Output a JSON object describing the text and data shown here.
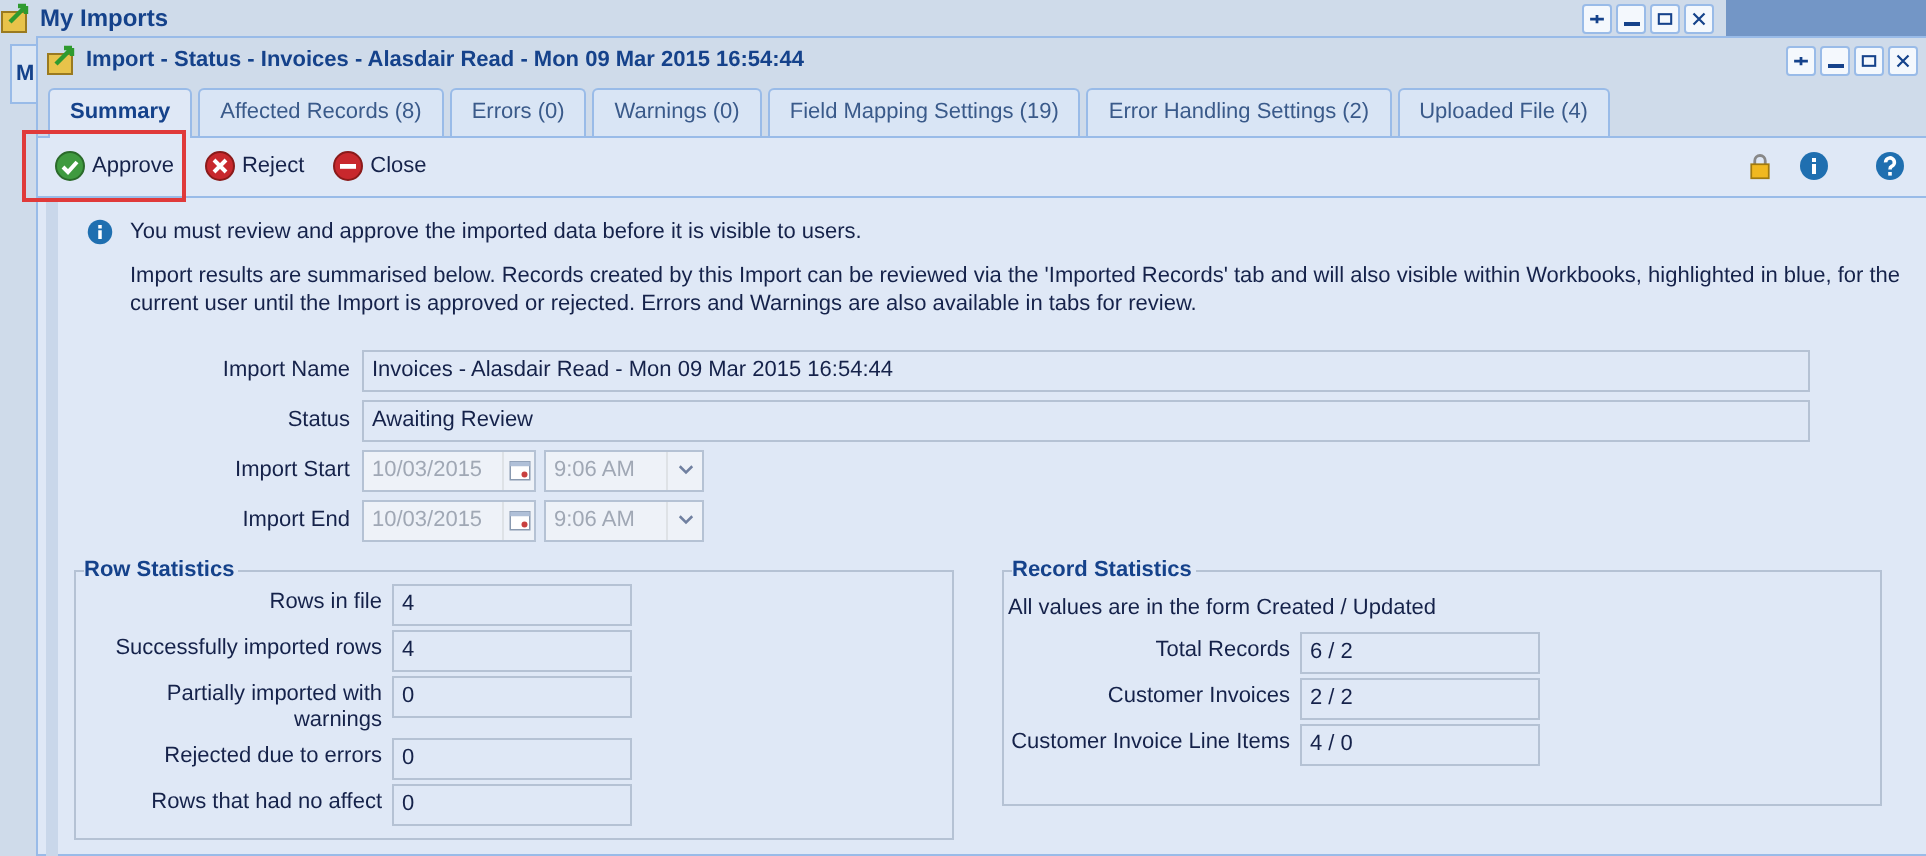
{
  "outer_window": {
    "title": "My Imports",
    "background_tab": "M"
  },
  "window": {
    "title": "Import - Status - Invoices - Alasdair Read - Mon 09 Mar 2015 16:54:44"
  },
  "tabs": [
    {
      "label": "Summary",
      "selected": true
    },
    {
      "label": "Affected Records (8)",
      "selected": false
    },
    {
      "label": "Errors (0)",
      "selected": false
    },
    {
      "label": "Warnings (0)",
      "selected": false
    },
    {
      "label": "Field Mapping Settings (19)",
      "selected": false
    },
    {
      "label": "Error Handling Settings (2)",
      "selected": false
    },
    {
      "label": "Uploaded File (4)",
      "selected": false
    }
  ],
  "toolbar": [
    {
      "kind": "approve",
      "label": "Approve",
      "highlighted": true
    },
    {
      "kind": "reject",
      "label": "Reject",
      "highlighted": false
    },
    {
      "kind": "close",
      "label": "Close",
      "highlighted": false
    }
  ],
  "notice": {
    "message": "You must review and approve the imported data before it is visible to users.",
    "details": "Import results are summarised below. Records created by this Import can be reviewed via the 'Imported Records' tab and will also visible within Workbooks, highlighted in blue, for the current user until the Import is approved or rejected. Errors and Warnings are also available in tabs for review."
  },
  "fields": [
    {
      "kind": "text",
      "label": "Import Name",
      "value": "Invoices - Alasdair Read - Mon 09 Mar 2015 16:54:44"
    },
    {
      "kind": "text",
      "label": "Status",
      "value": "Awaiting Review"
    },
    {
      "kind": "datetime",
      "label": "Import Start",
      "date": "10/03/2015",
      "time": "9:06 AM",
      "disabled": true
    },
    {
      "kind": "datetime",
      "label": "Import End",
      "date": "10/03/2015",
      "time": "9:06 AM",
      "disabled": true
    }
  ],
  "row_statistics": {
    "title": "Row Statistics",
    "rows": [
      {
        "label": "Rows in file",
        "value": "4"
      },
      {
        "label": "Successfully imported rows",
        "value": "4"
      },
      {
        "label": "Partially imported with warnings",
        "value": "0"
      },
      {
        "label": "Rejected due to errors",
        "value": "0"
      },
      {
        "label": "Rows that had no affect",
        "value": "0"
      }
    ]
  },
  "record_statistics": {
    "title": "Record Statistics",
    "note": "All values are in the form Created / Updated",
    "rows": [
      {
        "label": "Total Records",
        "value": "6 / 2"
      },
      {
        "label": "Customer Invoices",
        "value": "2 / 2"
      },
      {
        "label": "Customer Invoice Line Items",
        "value": "4 / 0"
      }
    ]
  }
}
